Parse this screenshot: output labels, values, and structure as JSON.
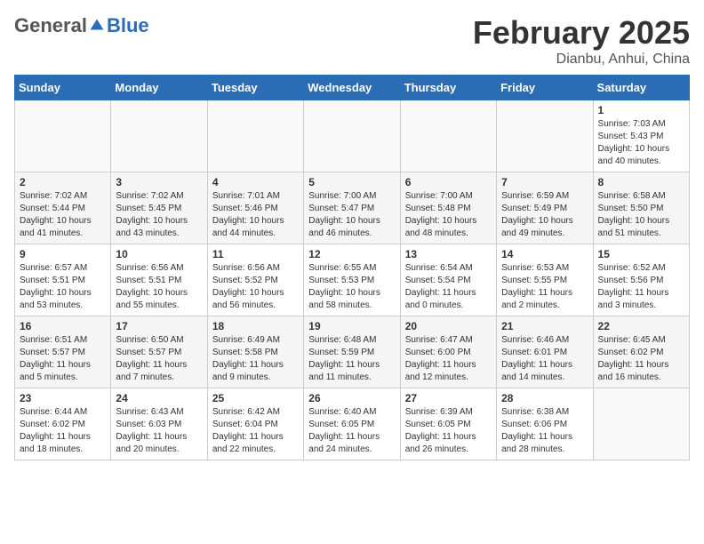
{
  "header": {
    "logo_general": "General",
    "logo_blue": "Blue",
    "month_title": "February 2025",
    "location": "Dianbu, Anhui, China"
  },
  "weekdays": [
    "Sunday",
    "Monday",
    "Tuesday",
    "Wednesday",
    "Thursday",
    "Friday",
    "Saturday"
  ],
  "weeks": [
    [
      {
        "day": "",
        "info": ""
      },
      {
        "day": "",
        "info": ""
      },
      {
        "day": "",
        "info": ""
      },
      {
        "day": "",
        "info": ""
      },
      {
        "day": "",
        "info": ""
      },
      {
        "day": "",
        "info": ""
      },
      {
        "day": "1",
        "info": "Sunrise: 7:03 AM\nSunset: 5:43 PM\nDaylight: 10 hours and 40 minutes."
      }
    ],
    [
      {
        "day": "2",
        "info": "Sunrise: 7:02 AM\nSunset: 5:44 PM\nDaylight: 10 hours and 41 minutes."
      },
      {
        "day": "3",
        "info": "Sunrise: 7:02 AM\nSunset: 5:45 PM\nDaylight: 10 hours and 43 minutes."
      },
      {
        "day": "4",
        "info": "Sunrise: 7:01 AM\nSunset: 5:46 PM\nDaylight: 10 hours and 44 minutes."
      },
      {
        "day": "5",
        "info": "Sunrise: 7:00 AM\nSunset: 5:47 PM\nDaylight: 10 hours and 46 minutes."
      },
      {
        "day": "6",
        "info": "Sunrise: 7:00 AM\nSunset: 5:48 PM\nDaylight: 10 hours and 48 minutes."
      },
      {
        "day": "7",
        "info": "Sunrise: 6:59 AM\nSunset: 5:49 PM\nDaylight: 10 hours and 49 minutes."
      },
      {
        "day": "8",
        "info": "Sunrise: 6:58 AM\nSunset: 5:50 PM\nDaylight: 10 hours and 51 minutes."
      }
    ],
    [
      {
        "day": "9",
        "info": "Sunrise: 6:57 AM\nSunset: 5:51 PM\nDaylight: 10 hours and 53 minutes."
      },
      {
        "day": "10",
        "info": "Sunrise: 6:56 AM\nSunset: 5:51 PM\nDaylight: 10 hours and 55 minutes."
      },
      {
        "day": "11",
        "info": "Sunrise: 6:56 AM\nSunset: 5:52 PM\nDaylight: 10 hours and 56 minutes."
      },
      {
        "day": "12",
        "info": "Sunrise: 6:55 AM\nSunset: 5:53 PM\nDaylight: 10 hours and 58 minutes."
      },
      {
        "day": "13",
        "info": "Sunrise: 6:54 AM\nSunset: 5:54 PM\nDaylight: 11 hours and 0 minutes."
      },
      {
        "day": "14",
        "info": "Sunrise: 6:53 AM\nSunset: 5:55 PM\nDaylight: 11 hours and 2 minutes."
      },
      {
        "day": "15",
        "info": "Sunrise: 6:52 AM\nSunset: 5:56 PM\nDaylight: 11 hours and 3 minutes."
      }
    ],
    [
      {
        "day": "16",
        "info": "Sunrise: 6:51 AM\nSunset: 5:57 PM\nDaylight: 11 hours and 5 minutes."
      },
      {
        "day": "17",
        "info": "Sunrise: 6:50 AM\nSunset: 5:57 PM\nDaylight: 11 hours and 7 minutes."
      },
      {
        "day": "18",
        "info": "Sunrise: 6:49 AM\nSunset: 5:58 PM\nDaylight: 11 hours and 9 minutes."
      },
      {
        "day": "19",
        "info": "Sunrise: 6:48 AM\nSunset: 5:59 PM\nDaylight: 11 hours and 11 minutes."
      },
      {
        "day": "20",
        "info": "Sunrise: 6:47 AM\nSunset: 6:00 PM\nDaylight: 11 hours and 12 minutes."
      },
      {
        "day": "21",
        "info": "Sunrise: 6:46 AM\nSunset: 6:01 PM\nDaylight: 11 hours and 14 minutes."
      },
      {
        "day": "22",
        "info": "Sunrise: 6:45 AM\nSunset: 6:02 PM\nDaylight: 11 hours and 16 minutes."
      }
    ],
    [
      {
        "day": "23",
        "info": "Sunrise: 6:44 AM\nSunset: 6:02 PM\nDaylight: 11 hours and 18 minutes."
      },
      {
        "day": "24",
        "info": "Sunrise: 6:43 AM\nSunset: 6:03 PM\nDaylight: 11 hours and 20 minutes."
      },
      {
        "day": "25",
        "info": "Sunrise: 6:42 AM\nSunset: 6:04 PM\nDaylight: 11 hours and 22 minutes."
      },
      {
        "day": "26",
        "info": "Sunrise: 6:40 AM\nSunset: 6:05 PM\nDaylight: 11 hours and 24 minutes."
      },
      {
        "day": "27",
        "info": "Sunrise: 6:39 AM\nSunset: 6:05 PM\nDaylight: 11 hours and 26 minutes."
      },
      {
        "day": "28",
        "info": "Sunrise: 6:38 AM\nSunset: 6:06 PM\nDaylight: 11 hours and 28 minutes."
      },
      {
        "day": "",
        "info": ""
      }
    ]
  ]
}
